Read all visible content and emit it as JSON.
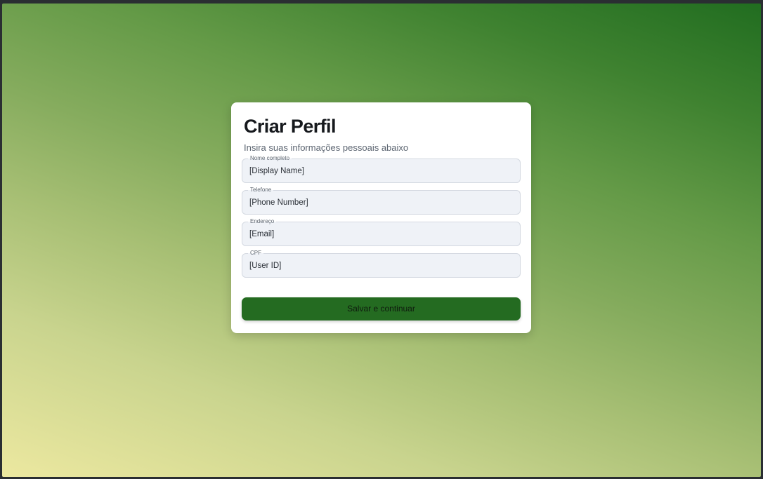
{
  "form": {
    "title": "Criar Perfil",
    "subtitle": "Insira suas informações pessoais abaixo",
    "fields": [
      {
        "label": "Nome completo",
        "value": "[Display Name]"
      },
      {
        "label": "Telefone",
        "value": "[Phone Number]"
      },
      {
        "label": "Endereço",
        "value": "[Email]"
      },
      {
        "label": "CPF",
        "value": "[User ID]"
      }
    ],
    "submit_label": "Salvar e continuar"
  },
  "colors": {
    "button": "#246b21",
    "field_background": "#eff2f7",
    "gradient_start": "#ece8a0",
    "gradient_end": "#216d20"
  }
}
